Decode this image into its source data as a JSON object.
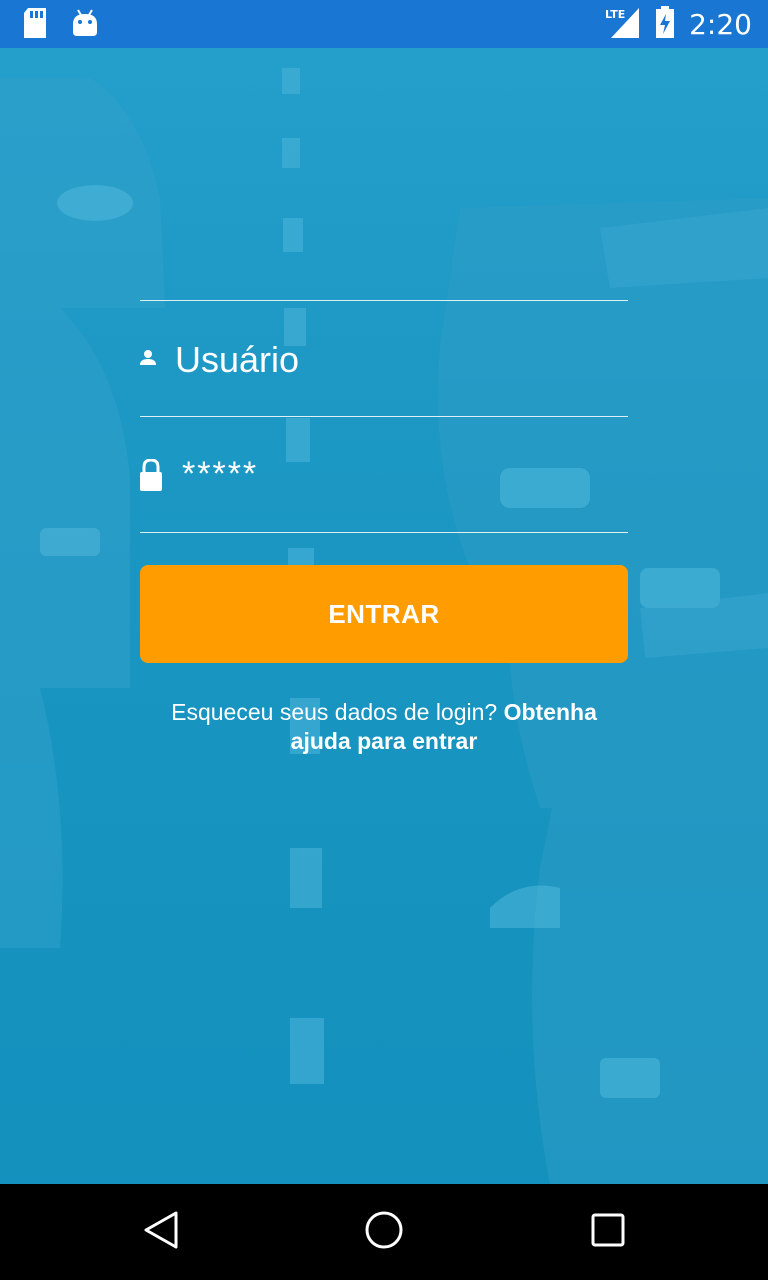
{
  "status_bar": {
    "time": "2:20",
    "network": "LTE"
  },
  "login": {
    "username_placeholder": "Usuário",
    "password_value": "*****",
    "button_label": "ENTRAR",
    "help_text": "Esqueceu seus dados de login?",
    "help_link": "Obtenha ajuda para entrar"
  },
  "colors": {
    "status_bar": "#1976d2",
    "background": "#1795c0",
    "button": "#ff9d00"
  },
  "icons": {
    "status_left": [
      "sd-card-icon",
      "android-icon"
    ],
    "status_right": [
      "lte-signal-icon",
      "battery-icon"
    ],
    "nav": [
      "back-icon",
      "home-icon",
      "recents-icon"
    ]
  }
}
